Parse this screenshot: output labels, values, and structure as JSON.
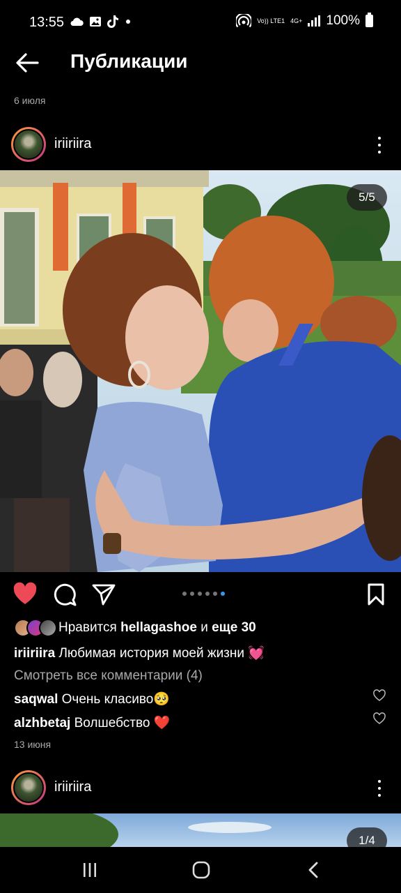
{
  "status_bar": {
    "time": "13:55",
    "battery": "100%",
    "network": "4G+",
    "volte": "Vo)) LTE1",
    "icons": [
      "cloud-icon",
      "gallery-icon",
      "tiktok-icon",
      "dot-icon",
      "hotspot-icon",
      "signal-icon",
      "battery-icon"
    ]
  },
  "header": {
    "title": "Публикации"
  },
  "date_above": "6 июля",
  "post1": {
    "username": "iriiriira",
    "counter": "5/5",
    "slide_current": 5,
    "slide_total": 5,
    "likes": {
      "prefix": "Нравится",
      "user": "hellagashoe",
      "and": "и",
      "others": "еще 30"
    },
    "caption": {
      "user": "iriiriira",
      "text": "Любимая история моей жизни 💓"
    },
    "view_comments": "Смотреть все комментарии (4)",
    "comments": [
      {
        "user": "saqwal",
        "text": "Очень класиво🥺"
      },
      {
        "user": "alzhbetaj",
        "text": "Волшебство ❤️"
      }
    ],
    "date": "13 июня"
  },
  "post2": {
    "username": "iriiriira",
    "counter": "1/4"
  },
  "colors": {
    "background": "#000000",
    "like_red": "#ed4956",
    "active_dot": "#3897f0",
    "secondary_text": "#a8a8a8"
  }
}
